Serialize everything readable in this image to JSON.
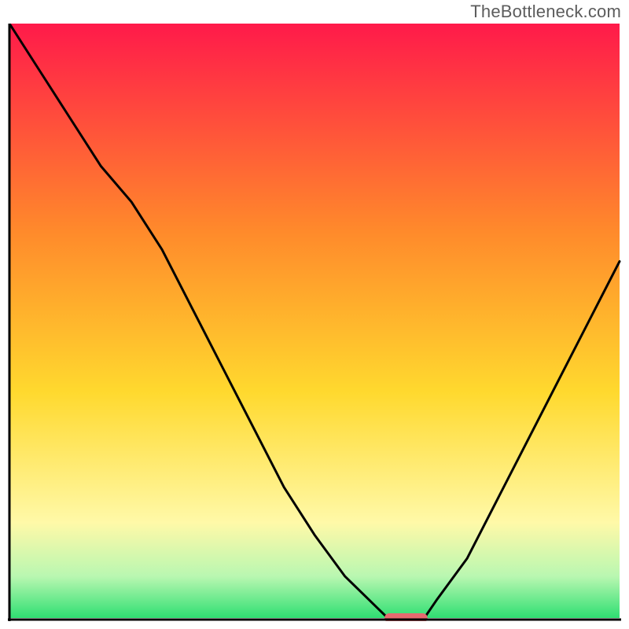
{
  "watermark": "TheBottleneck.com",
  "colors": {
    "gradient_top": "#ff1a4a",
    "gradient_mid_upper": "#ff8a2b",
    "gradient_mid": "#ffd92e",
    "gradient_lower": "#fff9a8",
    "gradient_green_light": "#b9f7b1",
    "gradient_green": "#2fdf72",
    "marker_fill": "#e66a6f",
    "curve": "#000000",
    "axis": "#000000"
  },
  "chart_data": {
    "type": "line",
    "title": "",
    "xlabel": "",
    "ylabel": "",
    "x": [
      0.0,
      0.05,
      0.1,
      0.15,
      0.2,
      0.25,
      0.3,
      0.35,
      0.4,
      0.45,
      0.5,
      0.55,
      0.6,
      0.62,
      0.65,
      0.68,
      0.7,
      0.75,
      0.8,
      0.85,
      0.9,
      0.95,
      1.0
    ],
    "values": [
      1.0,
      0.92,
      0.84,
      0.76,
      0.7,
      0.62,
      0.52,
      0.42,
      0.32,
      0.22,
      0.14,
      0.07,
      0.02,
      0.0,
      0.0,
      0.0,
      0.03,
      0.1,
      0.2,
      0.3,
      0.4,
      0.5,
      0.6
    ],
    "xlim": [
      0,
      1
    ],
    "ylim": [
      0,
      1
    ],
    "marker": {
      "x_start": 0.62,
      "x_end": 0.68,
      "y": 0.0
    }
  }
}
